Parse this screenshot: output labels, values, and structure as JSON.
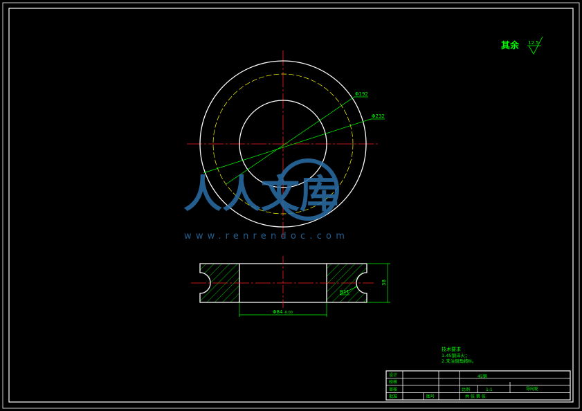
{
  "colors": {
    "background": "#000000",
    "outline": "#ffffff",
    "centerline": "#ff2020",
    "dimension": "#00ff00",
    "hidden_circle": "#ffff00",
    "watermark": "#2a6fa8"
  },
  "roughness_note": {
    "label": "其余",
    "value": "12.5"
  },
  "dimensions": {
    "d1": "Φ192",
    "d2": "Φ232",
    "bore": "Φ84",
    "bore_tol": "-0.00",
    "radius": "R11",
    "height": "38"
  },
  "tech_requirements": {
    "title": "技术要求",
    "items": [
      "1.45钢淬火；",
      "2.未注倒角按ⅡI。"
    ]
  },
  "title_block": {
    "rows": [
      "设计",
      "校核",
      "审核",
      "批准"
    ],
    "material": "45钢",
    "scale_label": "比例",
    "scale": "1:1",
    "part_name": "导向轮",
    "part_no_label": "图号",
    "sheet": "共  张   第  张"
  },
  "watermark": {
    "text": "人人文库",
    "url": "www.renrendoc.com"
  }
}
